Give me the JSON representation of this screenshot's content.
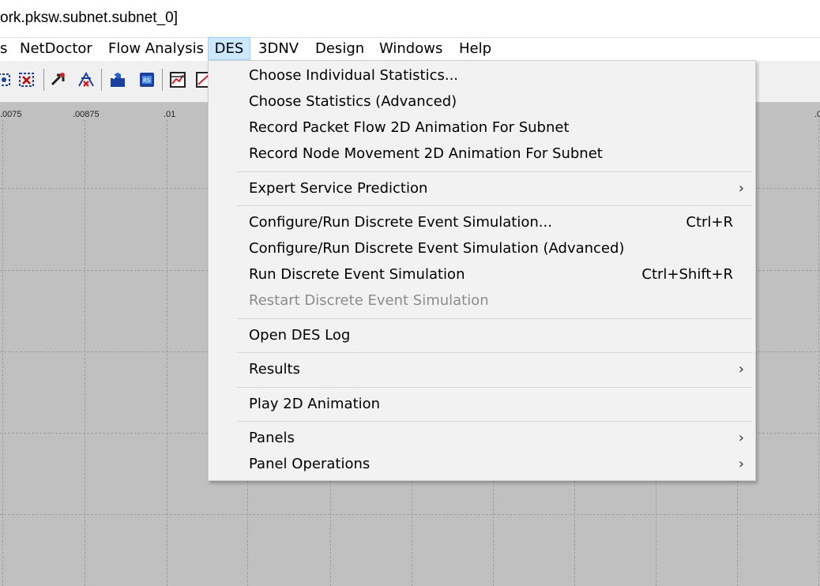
{
  "window": {
    "title": "ork.pksw.subnet.subnet_0]"
  },
  "menubar": {
    "items": [
      {
        "label": "s"
      },
      {
        "label": "NetDoctor"
      },
      {
        "label": "Flow Analysis"
      },
      {
        "label": "DES"
      },
      {
        "label": "3DNV"
      },
      {
        "label": "Design"
      },
      {
        "label": "Windows"
      },
      {
        "label": "Help"
      }
    ],
    "active": "DES"
  },
  "ruler": {
    "ticks": [
      ".0075",
      ".00875",
      ".01",
      ".0"
    ]
  },
  "des_menu": {
    "items": [
      {
        "label": "Choose Individual Statistics..."
      },
      {
        "label": "Choose Statistics (Advanced)"
      },
      {
        "label": "Record Packet Flow 2D Animation For Subnet"
      },
      {
        "label": "Record Node Movement 2D Animation For Subnet"
      },
      {
        "label": "Expert Service Prediction",
        "arrow": "›"
      },
      {
        "label": "Configure/Run Discrete Event Simulation...",
        "shortcut": "Ctrl+R"
      },
      {
        "label": "Configure/Run Discrete Event Simulation (Advanced)"
      },
      {
        "label": "Run Discrete Event Simulation",
        "shortcut": "Ctrl+Shift+R"
      },
      {
        "label": "Restart Discrete Event Simulation",
        "disabled": true
      },
      {
        "label": "Open DES Log"
      },
      {
        "label": "Results",
        "arrow": "›"
      },
      {
        "label": "Play 2D Animation"
      },
      {
        "label": "Panels",
        "arrow": "›"
      },
      {
        "label": "Panel Operations",
        "arrow": "›"
      }
    ]
  },
  "colors": {
    "menu_highlight": "#cce8ff",
    "canvas": "#c0c0c0",
    "menu_bg": "#f2f2f2"
  }
}
